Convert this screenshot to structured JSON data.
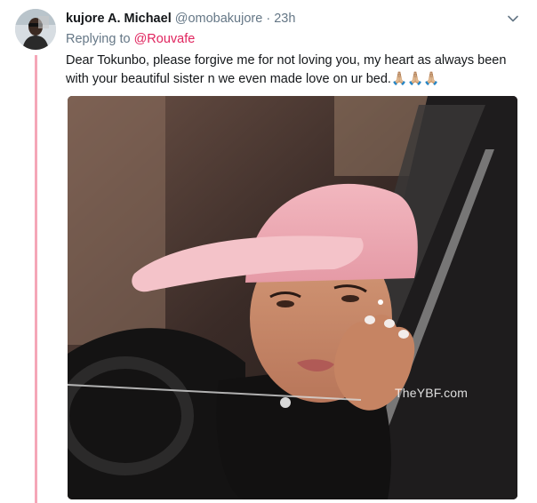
{
  "tweet": {
    "display_name": "kujore A. Michael",
    "handle": "@omobakujore",
    "separator": "·",
    "time": "23h",
    "replying_to_label": "Replying to",
    "replying_to_handle": "@Rouvafe",
    "text": "Dear Tokunbo, please forgive me for not loving you, my heart as always been with your beautiful sister n we even made love on ur bed.",
    "emoji": "🙏🏼🙏🏼🙏🏼",
    "media_watermark": "TheYBF.com"
  },
  "colors": {
    "thread_line": "#f5a7b8",
    "mention": "#e0245e",
    "meta": "#657786",
    "text": "#14171a"
  },
  "icons": {
    "avatar": "user-avatar",
    "caret": "chevron-down-icon"
  }
}
